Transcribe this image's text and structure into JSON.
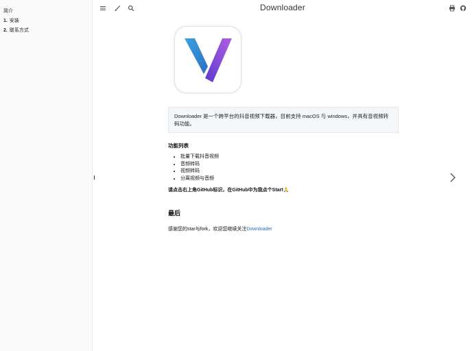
{
  "sidebar": {
    "intro": "简介",
    "items": [
      {
        "num": "1.",
        "label": "安装"
      },
      {
        "num": "2.",
        "label": "联系方式"
      }
    ]
  },
  "toolbar": {
    "title": "Downloader",
    "icons": [
      "menu-icon",
      "brush-icon",
      "search-icon",
      "print-icon",
      "github-icon"
    ]
  },
  "main": {
    "intro_text": "Downloader 是一个跨平台的抖音视频下载器，目前支持 macOS 与 windows，并具有音视频转码功能。",
    "features_heading": "功能列表",
    "features": [
      "批量下载抖音视频",
      "音频转码",
      "视频转码",
      "分离视频与音频"
    ],
    "star_line": "请点击右上角GitHub标识，在GitHub中为我点个Start🙏",
    "last_heading": "最后",
    "thanks_prefix": "感谢您的star与fork，欢迎您继续关注",
    "thanks_link": "Downloader"
  },
  "colors": {
    "link": "#2b6cb0",
    "logo_blue": "#2f8ad6",
    "logo_purple": "#7b42d6"
  }
}
